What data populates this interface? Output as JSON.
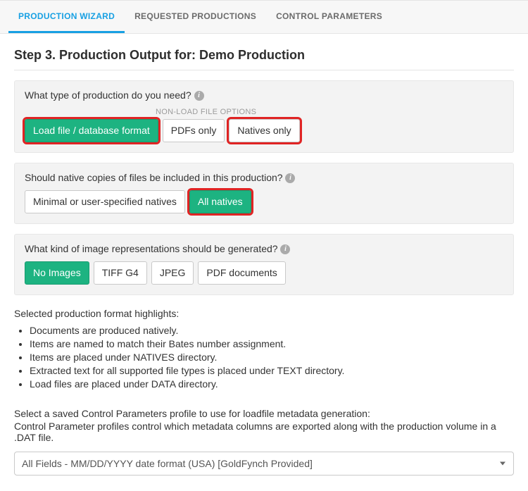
{
  "tabs": {
    "items": [
      {
        "label": "PRODUCTION WIZARD",
        "active": true
      },
      {
        "label": "REQUESTED PRODUCTIONS",
        "active": false
      },
      {
        "label": "CONTROL PARAMETERS",
        "active": false
      }
    ]
  },
  "step_heading": "Step 3. Production Output for: Demo Production",
  "panel_type": {
    "question": "What type of production do you need?",
    "non_load_label": "NON-LOAD FILE OPTIONS",
    "options": [
      {
        "label": "Load file / database format",
        "selected": true,
        "highlighted": true
      },
      {
        "label": "PDFs only",
        "selected": false,
        "highlighted": false
      },
      {
        "label": "Natives only",
        "selected": false,
        "highlighted": true
      }
    ]
  },
  "panel_natives": {
    "question": "Should native copies of files be included in this production?",
    "options": [
      {
        "label": "Minimal or user-specified natives",
        "selected": false,
        "highlighted": false
      },
      {
        "label": "All natives",
        "selected": true,
        "highlighted": true
      }
    ]
  },
  "panel_images": {
    "question": "What kind of image representations should be generated?",
    "options": [
      {
        "label": "No Images",
        "selected": true
      },
      {
        "label": "TIFF G4",
        "selected": false
      },
      {
        "label": "JPEG",
        "selected": false
      },
      {
        "label": "PDF documents",
        "selected": false
      }
    ]
  },
  "highlights": {
    "title": "Selected production format highlights:",
    "items": [
      "Documents are produced natively.",
      "Items are named to match their Bates number assignment.",
      "Items are placed under NATIVES directory.",
      "Extracted text for all supported file types is placed under TEXT directory.",
      "Load files are placed under DATA directory."
    ]
  },
  "control_params": {
    "label": "Select a saved Control Parameters profile to use for loadfile metadata generation:",
    "description": "Control Parameter profiles control which metadata columns are exported along with the production volume in a .DAT file.",
    "selected": "All Fields - MM/DD/YYYY date format (USA) [GoldFynch Provided]"
  }
}
